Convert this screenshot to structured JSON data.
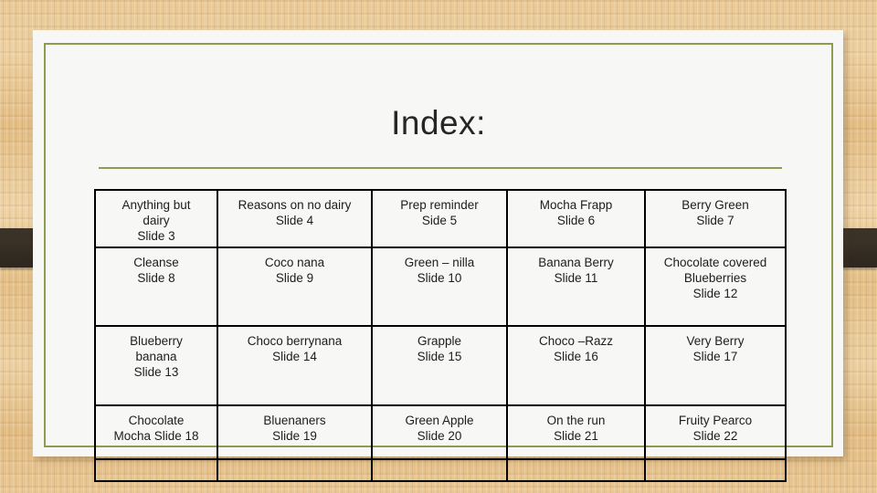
{
  "slide": {
    "title": "Index:",
    "theme": {
      "accent_olive": "#8d9c51",
      "sheet_background": "#f7f7f5",
      "desk_wood": "#e6c28d",
      "edge_bar": "#3a3127",
      "table_border": "#000000",
      "text": "#1d1d1d"
    }
  },
  "index_table": {
    "columns": 5,
    "rows": [
      {
        "cells": [
          {
            "lines": [
              "Anything but",
              "dairy",
              "Slide 3"
            ]
          },
          {
            "lines": [
              "Reasons on no dairy",
              "Slide 4"
            ]
          },
          {
            "lines": [
              "Prep reminder",
              "Side 5"
            ]
          },
          {
            "lines": [
              "Mocha Frapp",
              "Slide 6"
            ]
          },
          {
            "lines": [
              "Berry Green",
              "Slide 7"
            ]
          }
        ]
      },
      {
        "cells": [
          {
            "lines": [
              "Cleanse",
              "Slide 8"
            ]
          },
          {
            "lines": [
              "Coco nana",
              "Slide 9"
            ]
          },
          {
            "lines": [
              "Green – nilla",
              "Slide 10"
            ]
          },
          {
            "lines": [
              "Banana Berry",
              "Slide 11"
            ]
          },
          {
            "lines": [
              "Chocolate covered",
              "Blueberries",
              "Slide 12"
            ]
          }
        ]
      },
      {
        "cells": [
          {
            "lines": [
              "Blueberry",
              "banana",
              "Slide 13"
            ]
          },
          {
            "lines": [
              "Choco berrynana",
              "Slide 14"
            ]
          },
          {
            "lines": [
              "Grapple",
              "Slide 15"
            ]
          },
          {
            "lines": [
              "Choco –Razz",
              "Slide 16"
            ]
          },
          {
            "lines": [
              "Very Berry",
              "Slide 17"
            ]
          }
        ]
      },
      {
        "cells": [
          {
            "lines": [
              "Chocolate",
              "Mocha Slide 18"
            ]
          },
          {
            "lines": [
              "Bluenaners",
              "Slide 19"
            ]
          },
          {
            "lines": [
              "Green Apple",
              "Slide 20"
            ]
          },
          {
            "lines": [
              "On the run",
              "Slide 21"
            ]
          },
          {
            "lines": [
              "Fruity Pearco",
              "Slide 22"
            ]
          }
        ]
      },
      {
        "cells": [
          {
            "lines": []
          },
          {
            "lines": []
          },
          {
            "lines": []
          },
          {
            "lines": []
          },
          {
            "lines": []
          }
        ]
      }
    ]
  }
}
